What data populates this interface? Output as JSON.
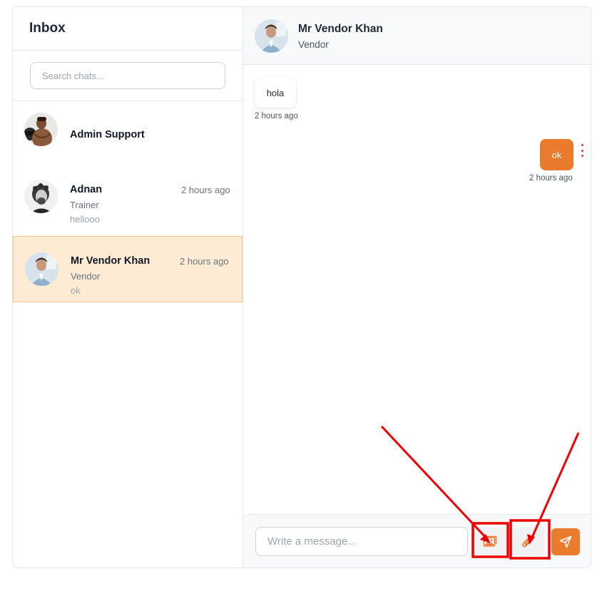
{
  "sidebar": {
    "title": "Inbox",
    "search_placeholder": "Search chats...",
    "chats": [
      {
        "name": "Admin Support",
        "time": "",
        "role": "",
        "last_message": ""
      },
      {
        "name": "Adnan",
        "time": "2 hours ago",
        "role": "Trainer",
        "last_message": "hellooo"
      },
      {
        "name": "Mr Vendor Khan",
        "time": "2 hours ago",
        "role": "Vendor",
        "last_message": "ok"
      }
    ]
  },
  "conversation": {
    "name": "Mr Vendor Khan",
    "role": "Vendor",
    "messages": [
      {
        "direction": "incoming",
        "text": "hola",
        "time": "2 hours ago"
      },
      {
        "direction": "outgoing",
        "text": "ok",
        "time": "2 hours ago"
      }
    ]
  },
  "composer": {
    "placeholder": "Write a message...",
    "buttons": [
      "image-icon",
      "paperclip-icon",
      "send-icon"
    ]
  },
  "colors": {
    "accent": "#ea7a2c",
    "active_chat_bg": "#fdebd3",
    "annotation_red": "#ee0000"
  }
}
